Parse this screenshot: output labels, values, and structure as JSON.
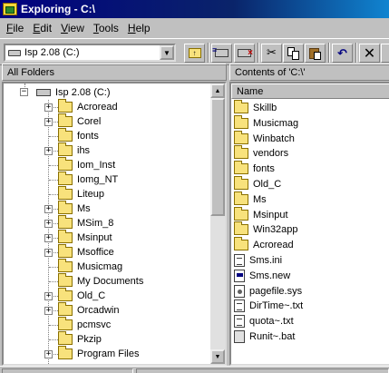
{
  "window": {
    "title": "Exploring - C:\\"
  },
  "menu": [
    {
      "label": "File",
      "key": "F",
      "rest": "ile"
    },
    {
      "label": "Edit",
      "key": "E",
      "rest": "dit"
    },
    {
      "label": "View",
      "key": "V",
      "rest": "iew"
    },
    {
      "label": "Tools",
      "key": "T",
      "rest": "ools"
    },
    {
      "label": "Help",
      "key": "H",
      "rest": "elp"
    }
  ],
  "toolbar": {
    "drive_select": "Isp 2.08 (C:)",
    "buttons": [
      "up-one-level-icon",
      "map-network-drive-icon",
      "disconnect-drive-icon",
      "cut-icon",
      "copy-icon",
      "paste-icon",
      "undo-icon",
      "delete-icon"
    ]
  },
  "panes": {
    "left_header": "All Folders",
    "right_header": "Contents of 'C:\\'"
  },
  "tree": {
    "root": "Isp 2.08 (C:)",
    "items": [
      {
        "label": "Acroread",
        "expandable": true
      },
      {
        "label": "Corel",
        "expandable": true
      },
      {
        "label": "fonts",
        "expandable": false
      },
      {
        "label": "ihs",
        "expandable": true
      },
      {
        "label": "Iom_Inst",
        "expandable": false
      },
      {
        "label": "Iomg_NT",
        "expandable": false
      },
      {
        "label": "Liteup",
        "expandable": false
      },
      {
        "label": "Ms",
        "expandable": true
      },
      {
        "label": "MSim_8",
        "expandable": true
      },
      {
        "label": "Msinput",
        "expandable": true
      },
      {
        "label": "Msoffice",
        "expandable": true
      },
      {
        "label": "Musicmag",
        "expandable": false
      },
      {
        "label": "My Documents",
        "expandable": false
      },
      {
        "label": "Old_C",
        "expandable": true
      },
      {
        "label": "Orcadwin",
        "expandable": true
      },
      {
        "label": "pcmsvc",
        "expandable": false
      },
      {
        "label": "Pkzip",
        "expandable": false
      },
      {
        "label": "Program Files",
        "expandable": true
      }
    ]
  },
  "list": {
    "column": "Name",
    "items": [
      {
        "name": "Skillb",
        "type": "folder"
      },
      {
        "name": "Musicmag",
        "type": "folder"
      },
      {
        "name": "Winbatch",
        "type": "folder"
      },
      {
        "name": "vendors",
        "type": "folder"
      },
      {
        "name": "fonts",
        "type": "folder"
      },
      {
        "name": "Old_C",
        "type": "folder"
      },
      {
        "name": "Ms",
        "type": "folder"
      },
      {
        "name": "Msinput",
        "type": "folder"
      },
      {
        "name": "Win32app",
        "type": "folder"
      },
      {
        "name": "Acroread",
        "type": "folder"
      },
      {
        "name": "Sms.ini",
        "type": "ini"
      },
      {
        "name": "Sms.new",
        "type": "new"
      },
      {
        "name": "pagefile.sys",
        "type": "sys"
      },
      {
        "name": "DirTime~.txt",
        "type": "txt"
      },
      {
        "name": "quota~.txt",
        "type": "txt"
      },
      {
        "name": "Runit~.bat",
        "type": "bat"
      }
    ]
  }
}
